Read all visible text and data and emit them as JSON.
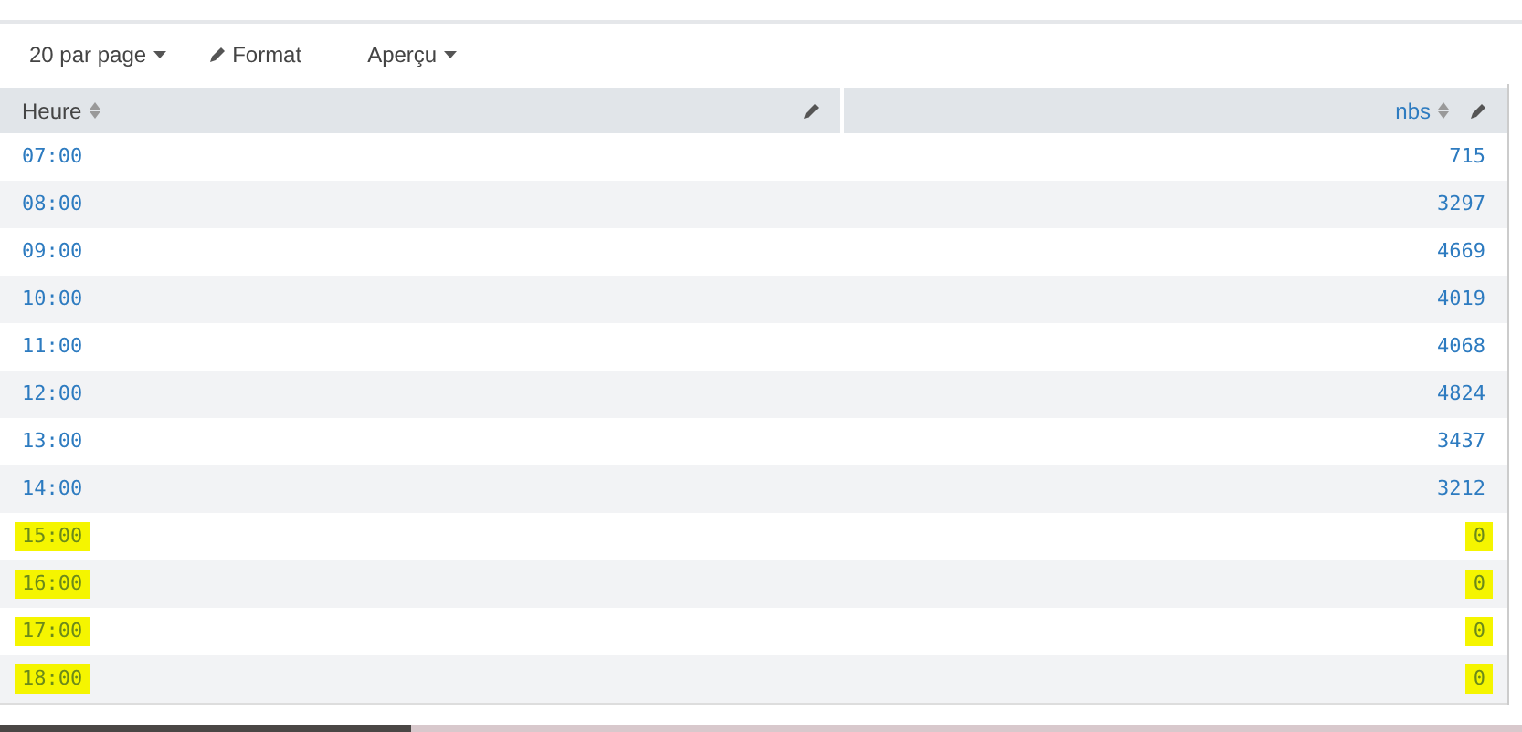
{
  "toolbar": {
    "page_size": "20 par page",
    "format": "Format",
    "preview": "Aperçu"
  },
  "table": {
    "columns": [
      "Heure",
      "nbs"
    ],
    "rows": [
      {
        "hour": "07:00",
        "value": "715",
        "highlighted": false
      },
      {
        "hour": "08:00",
        "value": "3297",
        "highlighted": false
      },
      {
        "hour": "09:00",
        "value": "4669",
        "highlighted": false
      },
      {
        "hour": "10:00",
        "value": "4019",
        "highlighted": false
      },
      {
        "hour": "11:00",
        "value": "4068",
        "highlighted": false
      },
      {
        "hour": "12:00",
        "value": "4824",
        "highlighted": false
      },
      {
        "hour": "13:00",
        "value": "3437",
        "highlighted": false
      },
      {
        "hour": "14:00",
        "value": "3212",
        "highlighted": false
      },
      {
        "hour": "15:00",
        "value": "0",
        "highlighted": true
      },
      {
        "hour": "16:00",
        "value": "0",
        "highlighted": true
      },
      {
        "hour": "17:00",
        "value": "0",
        "highlighted": true
      },
      {
        "hour": "18:00",
        "value": "0",
        "highlighted": true
      }
    ]
  }
}
